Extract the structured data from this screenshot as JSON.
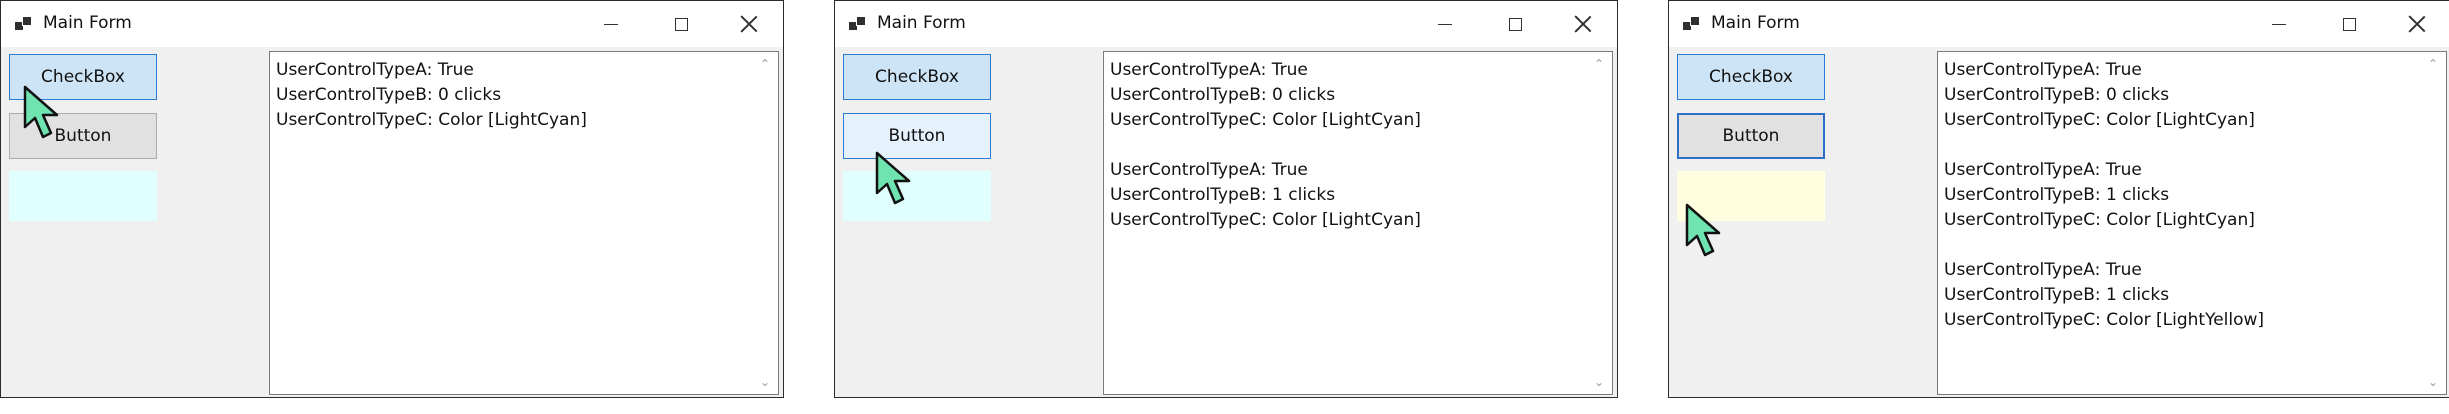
{
  "windows": [
    {
      "title": "Main Form",
      "checkbox_label": "CheckBox",
      "button_label": "Button",
      "button_state": "normal",
      "swatch_color": "#e0ffff",
      "lines": [
        "UserControlTypeA: True",
        "UserControlTypeB: 0 clicks",
        "UserControlTypeC: Color [LightCyan]"
      ]
    },
    {
      "title": "Main Form",
      "checkbox_label": "CheckBox",
      "button_label": "Button",
      "button_state": "hot",
      "swatch_color": "#e0ffff",
      "lines": [
        "UserControlTypeA: True",
        "UserControlTypeB: 0 clicks",
        "UserControlTypeC: Color [LightCyan]",
        "",
        "UserControlTypeA: True",
        "UserControlTypeB: 1 clicks",
        "UserControlTypeC: Color [LightCyan]"
      ]
    },
    {
      "title": "Main Form",
      "checkbox_label": "CheckBox",
      "button_label": "Button",
      "button_state": "focused",
      "swatch_color": "#ffffe0",
      "lines": [
        "UserControlTypeA: True",
        "UserControlTypeB: 0 clicks",
        "UserControlTypeC: Color [LightCyan]",
        "",
        "UserControlTypeA: True",
        "UserControlTypeB: 1 clicks",
        "UserControlTypeC: Color [LightCyan]",
        "",
        "UserControlTypeA: True",
        "UserControlTypeB: 1 clicks",
        "UserControlTypeC: Color [LightYellow]"
      ]
    }
  ],
  "icons": {
    "app": "app-icon",
    "minimize": "minimize-icon",
    "maximize": "maximize-icon",
    "close": "close-icon",
    "cursor": "mouse-cursor-icon"
  },
  "colors": {
    "cursor_fill": "#6fe3b0",
    "checkbox_bg": "#cde4f7",
    "accent_border": "#2c7ad4"
  }
}
